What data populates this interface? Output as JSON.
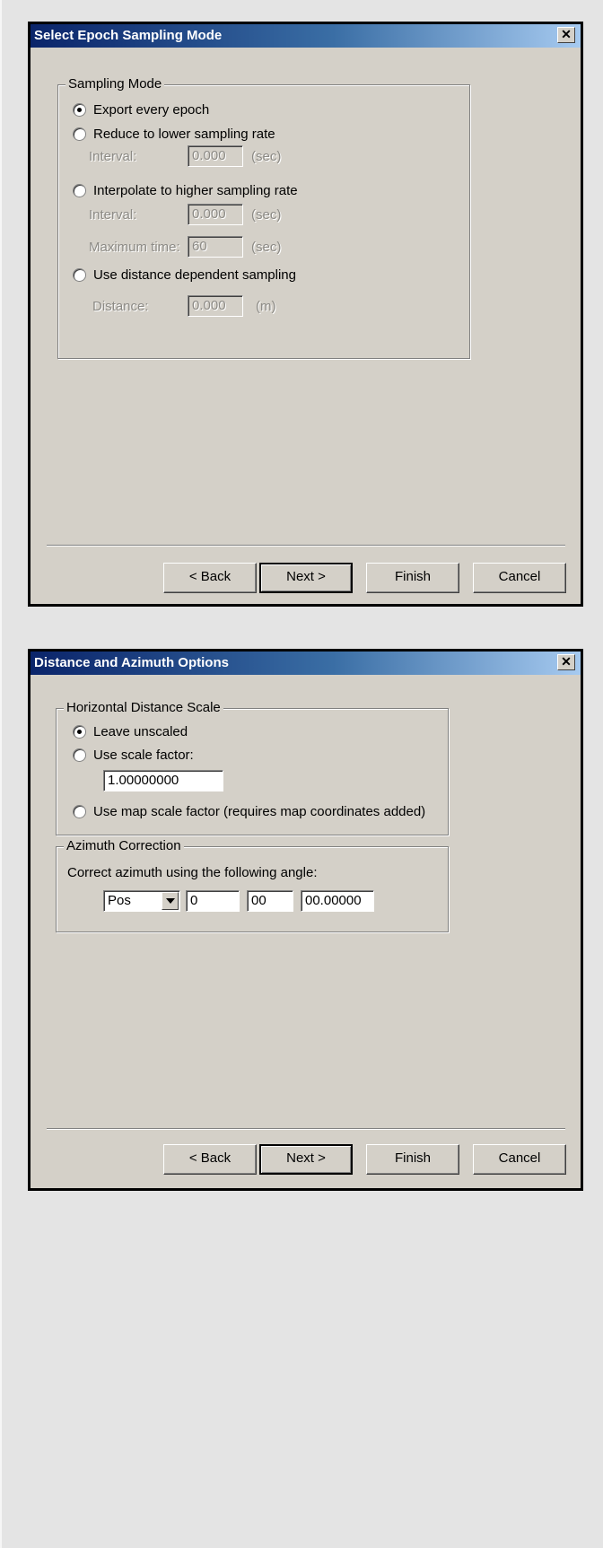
{
  "dialog1": {
    "title": "Select Epoch Sampling Mode",
    "close_glyph": "✕",
    "group": {
      "legend": "Sampling Mode",
      "options": [
        "Export every epoch",
        "Reduce to lower sampling rate",
        "Interpolate to higher sampling rate",
        "Use distance dependent sampling"
      ],
      "selected_option": "Export every epoch",
      "fields": {
        "reduce_interval": {
          "label": "Interval:",
          "value": "0.000",
          "unit": "(sec)"
        },
        "interp_interval": {
          "label": "Interval:",
          "value": "0.000",
          "unit": "(sec)"
        },
        "interp_max_time": {
          "label": "Maximum time:",
          "value": "60",
          "unit": "(sec)"
        },
        "distance": {
          "label": "Distance:",
          "value": "0.000",
          "unit": "(m)"
        }
      }
    },
    "buttons": {
      "back": "< Back",
      "next": "Next >",
      "finish": "Finish",
      "cancel": "Cancel"
    }
  },
  "dialog2": {
    "title": "Distance and Azimuth Options",
    "close_glyph": "✕",
    "distance_group": {
      "legend": "Horizontal Distance Scale",
      "options": [
        "Leave unscaled",
        "Use scale factor:",
        "Use map scale factor (requires map coordinates added)"
      ],
      "selected_option": "Leave unscaled",
      "scale_factor_value": "1.00000000"
    },
    "azimuth_group": {
      "legend": "Azimuth Correction",
      "instruction": "Correct azimuth using the following angle:",
      "sign_selected": "Pos",
      "degrees": "0",
      "minutes": "00",
      "seconds": "00.00000"
    },
    "buttons": {
      "back": "< Back",
      "next": "Next >",
      "finish": "Finish",
      "cancel": "Cancel"
    }
  }
}
